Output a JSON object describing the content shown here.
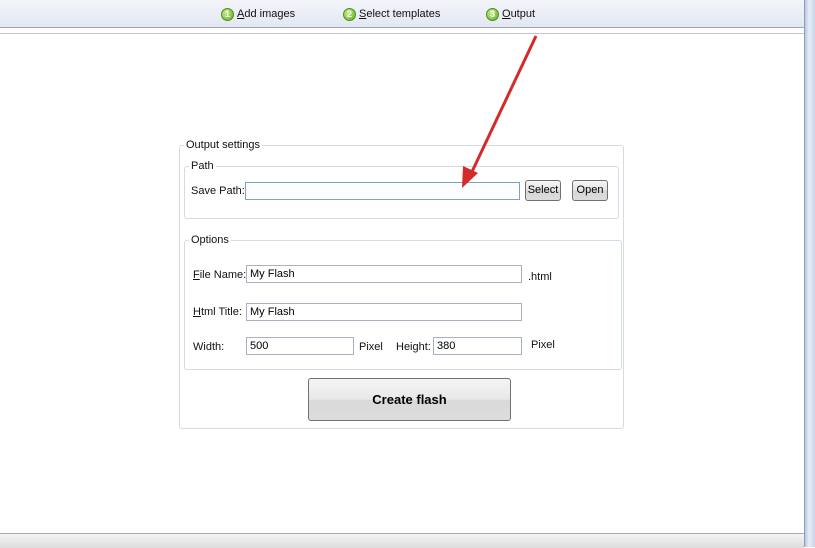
{
  "steps": [
    {
      "num": "1",
      "label": "Add images"
    },
    {
      "num": "2",
      "label": "Select templates"
    },
    {
      "num": "3",
      "label": "Output"
    }
  ],
  "output_settings": {
    "legend": "Output settings",
    "path": {
      "legend": "Path",
      "save_path_label": "Save Path:",
      "save_path_value": "",
      "select_label": "Select",
      "open_label": "Open"
    },
    "options": {
      "legend": "Options",
      "file_name_label": "File Name:",
      "file_name_value": "My Flash",
      "file_ext": ".html",
      "html_title_label": "Html Title:",
      "html_title_value": "My Flash",
      "width_label": "Width:",
      "width_value": "500",
      "width_unit": "Pixel",
      "height_label": "Height:",
      "height_value": "380",
      "height_unit": "Pixel"
    },
    "create_label": "Create flash"
  },
  "annotation_arrow_color": "#d42a2a"
}
